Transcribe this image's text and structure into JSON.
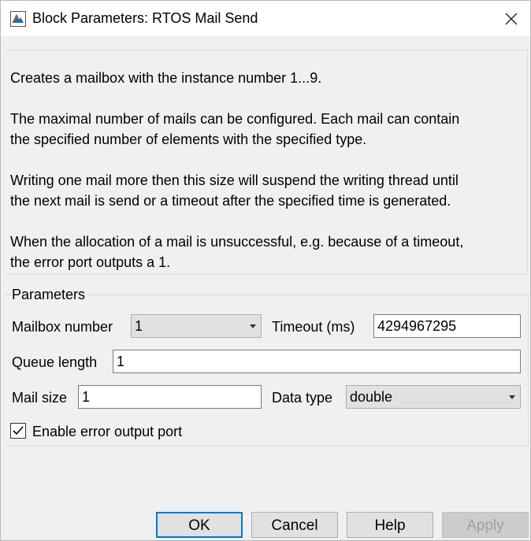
{
  "window": {
    "title": "Block Parameters: RTOS Mail Send",
    "close_glyph": "✕"
  },
  "description": [
    "Creates a mailbox with the instance number 1...9.",
    "The maximal number of mails can be configured. Each mail can contain",
    "the specified number of elements with the specified type.",
    "Writing one mail more then this size will suspend the writing thread until",
    "the next mail is send or a timeout after the specified time is generated.",
    "When the allocation of a mail is unsuccessful, e.g. because of a timeout,",
    "the error port outputs a 1."
  ],
  "parameters": {
    "group_title": "Parameters",
    "mailbox_number_label": "Mailbox number",
    "mailbox_number_value": "1",
    "timeout_label": "Timeout (ms)",
    "timeout_value": "4294967295",
    "queue_length_label": "Queue length",
    "queue_length_value": "1",
    "mail_size_label": "Mail size",
    "mail_size_value": "1",
    "data_type_label": "Data type",
    "data_type_value": "double",
    "enable_error_label": "Enable error output port",
    "enable_error_checked": true
  },
  "buttons": {
    "ok": "OK",
    "cancel": "Cancel",
    "help": "Help",
    "apply": "Apply"
  },
  "colors": {
    "accent": "#0078d7",
    "window_bg": "#f0f0f0"
  }
}
